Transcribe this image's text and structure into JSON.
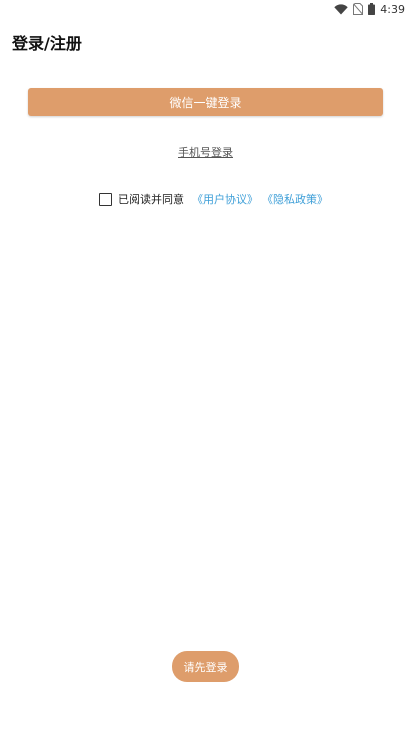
{
  "status_bar": {
    "time": "4:39",
    "icons": [
      "wifi-icon",
      "no-sim-icon",
      "battery-icon"
    ]
  },
  "header": {
    "title": "登录/注册"
  },
  "login": {
    "wechat_button": "微信一键登录",
    "phone_link": "手机号登录"
  },
  "agreement": {
    "checked": false,
    "prefix": "已阅读并同意",
    "user_agreement": "《用户协议》",
    "privacy_policy": "《隐私政策》"
  },
  "footer": {
    "login_first_button": "请先登录"
  },
  "colors": {
    "accent": "#DE9D6B",
    "link": "#3E9FD8"
  }
}
